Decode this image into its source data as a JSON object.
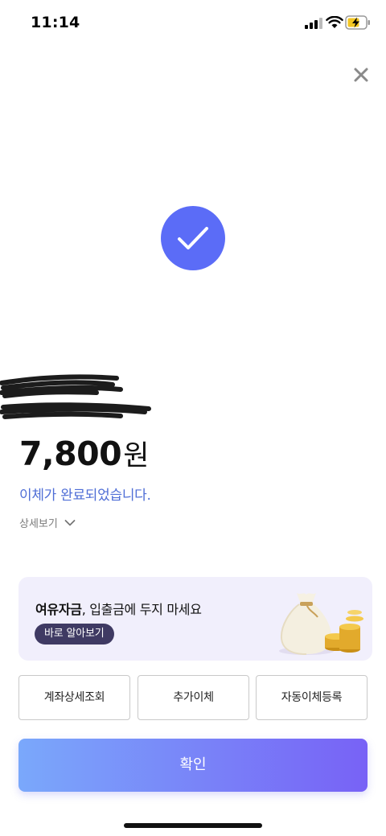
{
  "status_bar": {
    "time": "11:14",
    "icons": [
      "signal-icon",
      "wifi-icon",
      "battery-charging-icon"
    ]
  },
  "header": {
    "close_icon": "close-icon"
  },
  "result": {
    "icon": "check-icon",
    "accent_color": "#5b6cf7",
    "amount": "7,800",
    "currency": "원",
    "message": "이체가 완료되었습니다.",
    "message_color": "#4f6ed6",
    "detail_label": "상세보기"
  },
  "promo": {
    "title_bold": "여유자금",
    "title_rest": ", 입출금에 두지 마세요",
    "cta_label": "바로 알아보기",
    "icon": "money-bag-icon"
  },
  "actions": {
    "account_detail_label": "계좌상세조회",
    "additional_transfer_label": "추가이체",
    "auto_transfer_label": "자동이체등록"
  },
  "confirm_label": "확인"
}
